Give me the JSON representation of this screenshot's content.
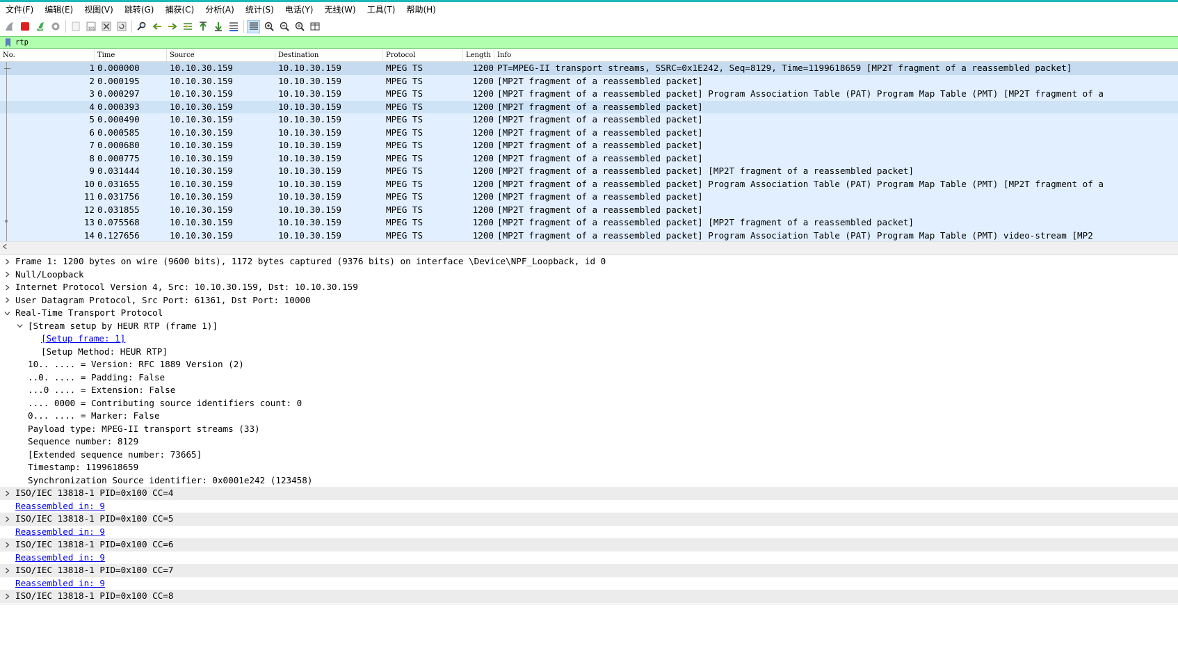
{
  "menubar": {
    "items": [
      "文件(F)",
      "编辑(E)",
      "视图(V)",
      "跳转(G)",
      "捕获(C)",
      "分析(A)",
      "统计(S)",
      "电话(Y)",
      "无线(W)",
      "工具(T)",
      "帮助(H)"
    ]
  },
  "toolbar": {
    "icons": [
      "shark-fin-start-icon",
      "stop-icon",
      "restart-icon",
      "capture-options-icon",
      "open-file-icon",
      "save-file-icon",
      "close-file-icon",
      "reload-icon",
      "find-icon",
      "go-back-icon",
      "go-forward-icon",
      "go-to-packet-icon",
      "first-packet-icon",
      "last-packet-icon",
      "auto-scroll-icon",
      "colorize-icon",
      "zoom-in-icon",
      "zoom-out-icon",
      "zoom-normal-icon",
      "resize-columns-icon"
    ]
  },
  "filter": {
    "value": "rtp"
  },
  "packet_list": {
    "columns": [
      "No.",
      "Time",
      "Source",
      "Destination",
      "Protocol",
      "Length",
      "Info"
    ],
    "rows": [
      {
        "no": "1",
        "time": "0.000000",
        "src": "10.10.30.159",
        "dst": "10.10.30.159",
        "proto": "MPEG TS",
        "len": "1200",
        "info": "PT=MPEG-II transport streams, SSRC=0x1E242, Seq=8129, Time=1199618659 [MP2T fragment of a reassembled packet]"
      },
      {
        "no": "2",
        "time": "0.000195",
        "src": "10.10.30.159",
        "dst": "10.10.30.159",
        "proto": "MPEG TS",
        "len": "1200",
        "info": "[MP2T fragment of a reassembled packet]"
      },
      {
        "no": "3",
        "time": "0.000297",
        "src": "10.10.30.159",
        "dst": "10.10.30.159",
        "proto": "MPEG TS",
        "len": "1200",
        "info": "[MP2T fragment of a reassembled packet] Program Association Table (PAT)  Program Map Table (PMT) [MP2T fragment of a"
      },
      {
        "no": "4",
        "time": "0.000393",
        "src": "10.10.30.159",
        "dst": "10.10.30.159",
        "proto": "MPEG TS",
        "len": "1200",
        "info": "[MP2T fragment of a reassembled packet]"
      },
      {
        "no": "5",
        "time": "0.000490",
        "src": "10.10.30.159",
        "dst": "10.10.30.159",
        "proto": "MPEG TS",
        "len": "1200",
        "info": "[MP2T fragment of a reassembled packet]"
      },
      {
        "no": "6",
        "time": "0.000585",
        "src": "10.10.30.159",
        "dst": "10.10.30.159",
        "proto": "MPEG TS",
        "len": "1200",
        "info": "[MP2T fragment of a reassembled packet]"
      },
      {
        "no": "7",
        "time": "0.000680",
        "src": "10.10.30.159",
        "dst": "10.10.30.159",
        "proto": "MPEG TS",
        "len": "1200",
        "info": "[MP2T fragment of a reassembled packet]"
      },
      {
        "no": "8",
        "time": "0.000775",
        "src": "10.10.30.159",
        "dst": "10.10.30.159",
        "proto": "MPEG TS",
        "len": "1200",
        "info": "[MP2T fragment of a reassembled packet]"
      },
      {
        "no": "9",
        "time": "0.031444",
        "src": "10.10.30.159",
        "dst": "10.10.30.159",
        "proto": "MPEG TS",
        "len": "1200",
        "info": "[MP2T fragment of a reassembled packet] [MP2T fragment of a reassembled packet]"
      },
      {
        "no": "10",
        "time": "0.031655",
        "src": "10.10.30.159",
        "dst": "10.10.30.159",
        "proto": "MPEG TS",
        "len": "1200",
        "info": "[MP2T fragment of a reassembled packet] Program Association Table (PAT)  Program Map Table (PMT) [MP2T fragment of a"
      },
      {
        "no": "11",
        "time": "0.031756",
        "src": "10.10.30.159",
        "dst": "10.10.30.159",
        "proto": "MPEG TS",
        "len": "1200",
        "info": "[MP2T fragment of a reassembled packet]"
      },
      {
        "no": "12",
        "time": "0.031855",
        "src": "10.10.30.159",
        "dst": "10.10.30.159",
        "proto": "MPEG TS",
        "len": "1200",
        "info": "[MP2T fragment of a reassembled packet]"
      },
      {
        "no": "13",
        "time": "0.075568",
        "src": "10.10.30.159",
        "dst": "10.10.30.159",
        "proto": "MPEG TS",
        "len": "1200",
        "info": "[MP2T fragment of a reassembled packet] [MP2T fragment of a reassembled packet]"
      },
      {
        "no": "14",
        "time": "0.127656",
        "src": "10.10.30.159",
        "dst": "10.10.30.159",
        "proto": "MPEG TS",
        "len": "1200",
        "info": "[MP2T fragment of a reassembled packet] Program Association Table (PAT)  Program Map Table (PMT) video-stream  [MP2"
      }
    ]
  },
  "details": {
    "rows": [
      {
        "indent": 0,
        "twisty": "right",
        "text": "Frame 1: 1200 bytes on wire (9600 bits), 1172 bytes captured (9376 bits) on interface \\Device\\NPF_Loopback, id 0",
        "link": false,
        "alt": false
      },
      {
        "indent": 0,
        "twisty": "right",
        "text": "Null/Loopback",
        "link": false,
        "alt": false
      },
      {
        "indent": 0,
        "twisty": "right",
        "text": "Internet Protocol Version 4, Src: 10.10.30.159, Dst: 10.10.30.159",
        "link": false,
        "alt": false
      },
      {
        "indent": 0,
        "twisty": "right",
        "text": "User Datagram Protocol, Src Port: 61361, Dst Port: 10000",
        "link": false,
        "alt": false
      },
      {
        "indent": 0,
        "twisty": "down",
        "text": "Real-Time Transport Protocol",
        "link": false,
        "alt": false
      },
      {
        "indent": 1,
        "twisty": "down",
        "text": "[Stream setup by HEUR RTP (frame 1)]",
        "link": false,
        "alt": false
      },
      {
        "indent": 2,
        "twisty": "",
        "text": "[Setup frame: 1]",
        "link": true,
        "alt": false
      },
      {
        "indent": 2,
        "twisty": "",
        "text": "[Setup Method: HEUR RTP]",
        "link": false,
        "alt": false
      },
      {
        "indent": 1,
        "twisty": "",
        "text": "10.. .... = Version: RFC 1889 Version (2)",
        "link": false,
        "alt": false
      },
      {
        "indent": 1,
        "twisty": "",
        "text": "..0. .... = Padding: False",
        "link": false,
        "alt": false
      },
      {
        "indent": 1,
        "twisty": "",
        "text": "...0 .... = Extension: False",
        "link": false,
        "alt": false
      },
      {
        "indent": 1,
        "twisty": "",
        "text": ".... 0000 = Contributing source identifiers count: 0",
        "link": false,
        "alt": false
      },
      {
        "indent": 1,
        "twisty": "",
        "text": "0... .... = Marker: False",
        "link": false,
        "alt": false
      },
      {
        "indent": 1,
        "twisty": "",
        "text": "Payload type: MPEG-II transport streams (33)",
        "link": false,
        "alt": false
      },
      {
        "indent": 1,
        "twisty": "",
        "text": "Sequence number: 8129",
        "link": false,
        "alt": false
      },
      {
        "indent": 1,
        "twisty": "",
        "text": "[Extended sequence number: 73665]",
        "link": false,
        "alt": false
      },
      {
        "indent": 1,
        "twisty": "",
        "text": "Timestamp: 1199618659",
        "link": false,
        "alt": false
      },
      {
        "indent": 1,
        "twisty": "",
        "text": "Synchronization Source identifier: 0x0001e242 (123458)",
        "link": false,
        "alt": false
      },
      {
        "indent": 0,
        "twisty": "right",
        "text": "ISO/IEC 13818-1 PID=0x100 CC=4",
        "link": false,
        "alt": true
      },
      {
        "indent": 0,
        "twisty": "",
        "text": "Reassembled in: 9",
        "link": true,
        "alt": false
      },
      {
        "indent": 0,
        "twisty": "right",
        "text": "ISO/IEC 13818-1 PID=0x100 CC=5",
        "link": false,
        "alt": true
      },
      {
        "indent": 0,
        "twisty": "",
        "text": "Reassembled in: 9",
        "link": true,
        "alt": false
      },
      {
        "indent": 0,
        "twisty": "right",
        "text": "ISO/IEC 13818-1 PID=0x100 CC=6",
        "link": false,
        "alt": true
      },
      {
        "indent": 0,
        "twisty": "",
        "text": "Reassembled in: 9",
        "link": true,
        "alt": false
      },
      {
        "indent": 0,
        "twisty": "right",
        "text": "ISO/IEC 13818-1 PID=0x100 CC=7",
        "link": false,
        "alt": true
      },
      {
        "indent": 0,
        "twisty": "",
        "text": "Reassembled in: 9",
        "link": true,
        "alt": false
      },
      {
        "indent": 0,
        "twisty": "right",
        "text": "ISO/IEC 13818-1 PID=0x100 CC=8",
        "link": false,
        "alt": true
      }
    ]
  },
  "colors": {
    "filter_bg": "#afffaf",
    "row_bg": "#e1efff",
    "selected_row_bg": "#c6dbef",
    "link": "#0000ee",
    "accent_top": "#1fb8b8"
  }
}
